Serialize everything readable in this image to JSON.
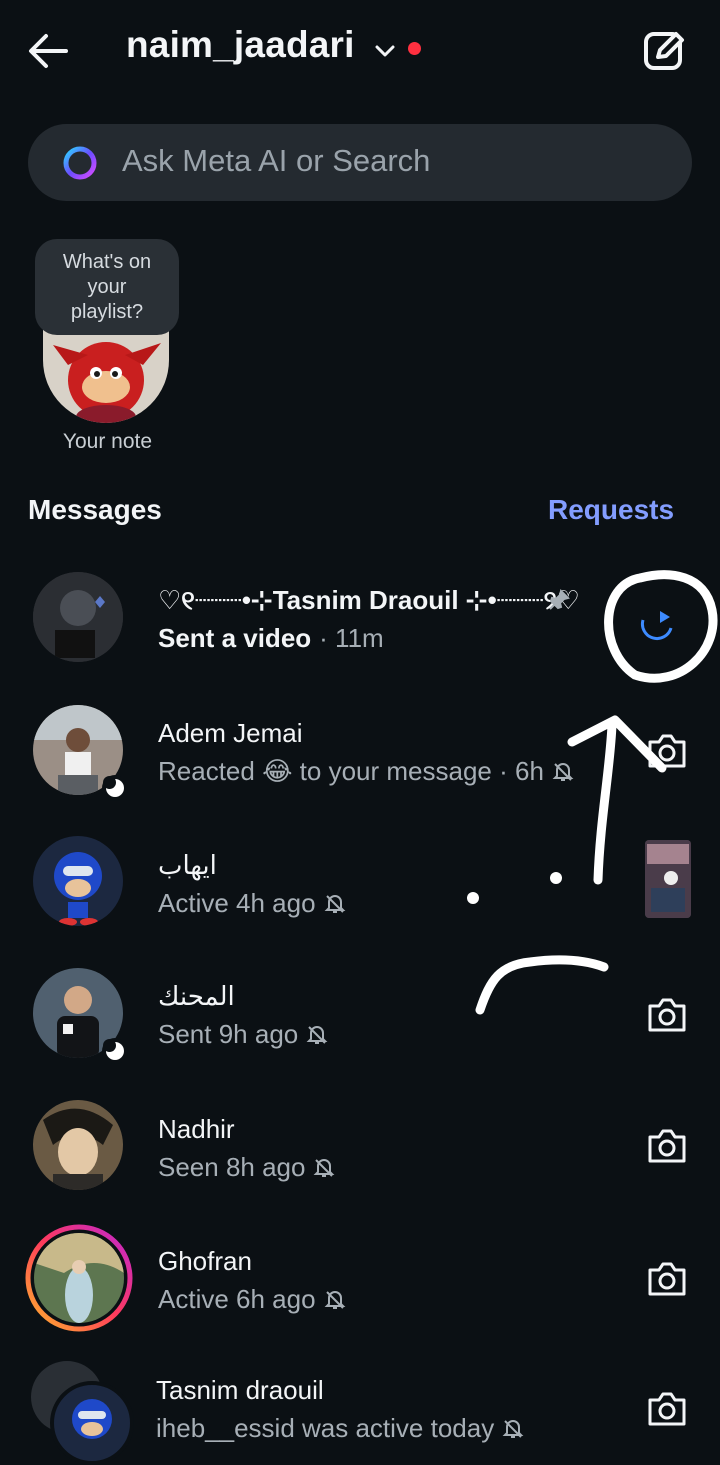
{
  "header": {
    "account_name": "naim_jaadari",
    "compose_icon": "edit-square-icon"
  },
  "search": {
    "placeholder": "Ask Meta AI or Search"
  },
  "note": {
    "bubble_text": "What's on your playlist?",
    "label": "Your note"
  },
  "section": {
    "title": "Messages",
    "requests_label": "Requests"
  },
  "conversations": [
    {
      "name": "♡୧┈┈┈•⊹Tasnim Draouil ⊹•┈┈┈୨♡",
      "preview": "Sent a video",
      "time": "· 11m",
      "pinned": true,
      "unread": true
    },
    {
      "name": "Adem Jemai",
      "preview": "Reacted 😂 to your message · 6h",
      "muted": true
    },
    {
      "name": "ايهاب",
      "preview": "Active 4h ago",
      "muted": true
    },
    {
      "name": "المحنك",
      "preview": "Sent 9h ago",
      "muted": true
    },
    {
      "name": "Nadhir",
      "preview": "Seen 8h ago",
      "muted": true
    },
    {
      "name": "Ghofran",
      "preview": "Active 6h ago",
      "muted": true,
      "story_ring": true
    },
    {
      "name": "Tasnim draouil",
      "preview": "iheb__essid was active today",
      "muted": true
    }
  ],
  "colors": {
    "background": "#0b1014",
    "accent": "#839dff",
    "notification_dot": "#ff3040",
    "unread_play": "#3d8bff"
  }
}
